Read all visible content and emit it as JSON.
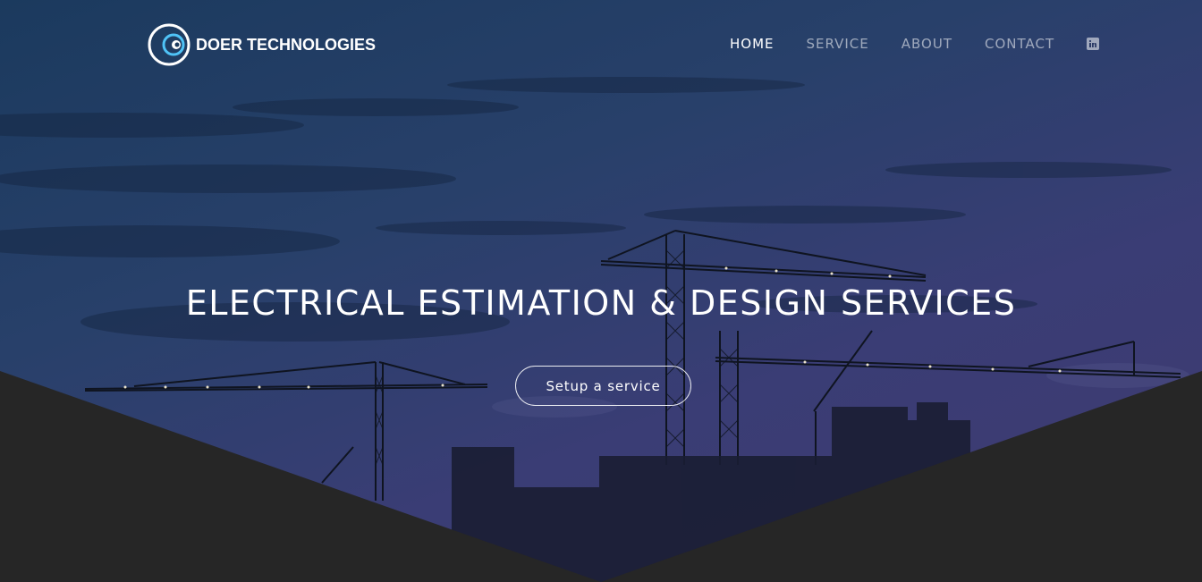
{
  "brand": {
    "name": "DOER TECHNOLOGIES"
  },
  "nav": {
    "items": [
      {
        "label": "HOME",
        "active": true
      },
      {
        "label": "SERVICE",
        "active": false
      },
      {
        "label": "ABOUT",
        "active": false
      },
      {
        "label": "CONTACT",
        "active": false
      }
    ],
    "social_icon": "linkedin-icon"
  },
  "hero": {
    "headline": "ELECTRICAL ESTIMATION & DESIGN SERVICES",
    "cta_label": "Setup a service"
  },
  "colors": {
    "footer_shape": "#262626",
    "sky_top": "#1b3a5e",
    "sky_bottom": "#3f3a70",
    "logo_blue": "#1e88e5"
  }
}
